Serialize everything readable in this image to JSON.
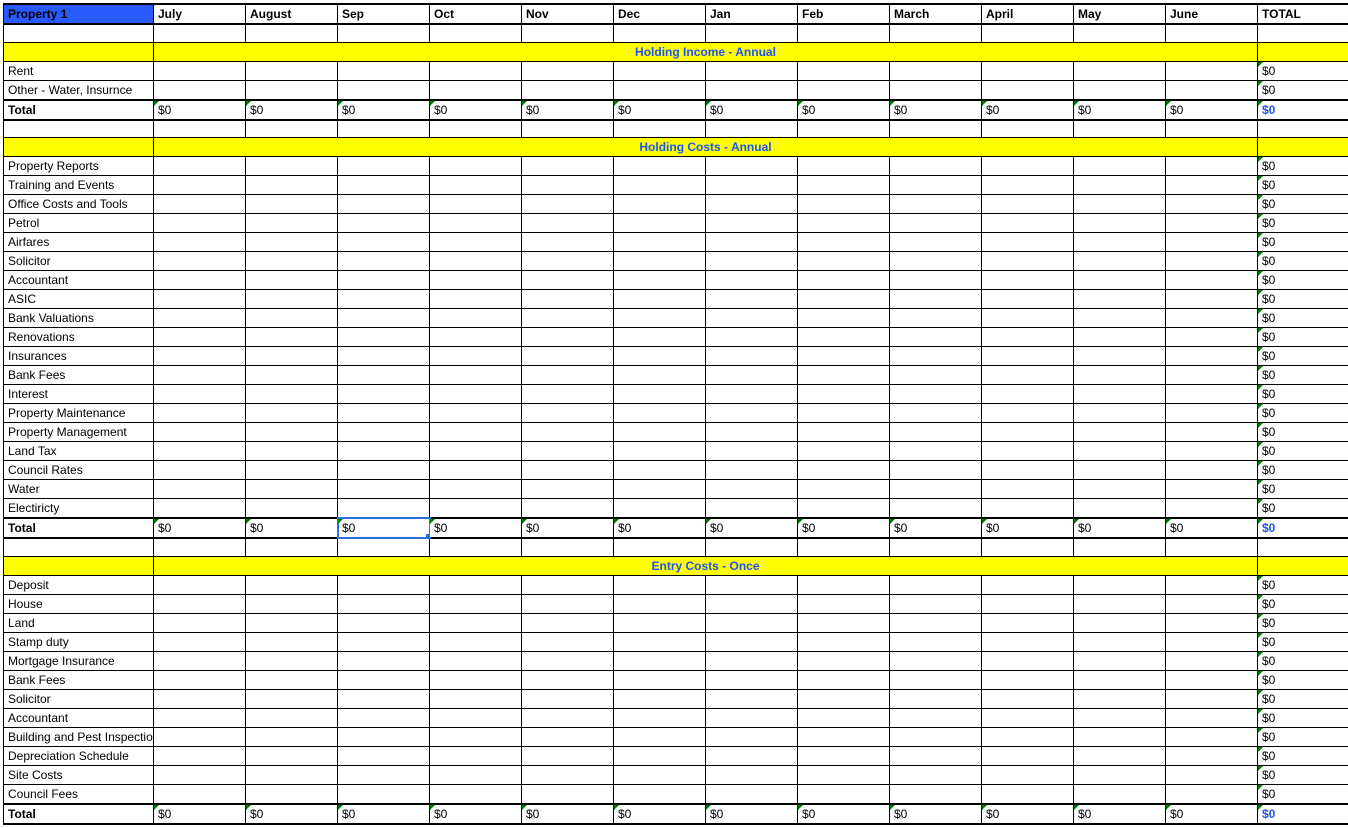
{
  "header": {
    "title": "Property 1",
    "months": [
      "July",
      "August",
      "Sep",
      "Oct",
      "Nov",
      "Dec",
      "Jan",
      "Feb",
      "March",
      "April",
      "May",
      "June"
    ],
    "total_label": "TOTAL"
  },
  "sections": [
    {
      "title": "Holding Income - Annual",
      "rows": [
        {
          "label": "Rent",
          "total": "$0"
        },
        {
          "label": "Other - Water, Insurnce",
          "total": "$0"
        }
      ],
      "total": {
        "label": "Total",
        "months": [
          "$0",
          "$0",
          "$0",
          "$0",
          "$0",
          "$0",
          "$0",
          "$0",
          "$0",
          "$0",
          "$0",
          "$0"
        ],
        "grand": "$0"
      }
    },
    {
      "title": "Holding Costs - Annual",
      "rows": [
        {
          "label": "Property Reports",
          "total": "$0"
        },
        {
          "label": "Training and Events",
          "total": "$0"
        },
        {
          "label": "Office Costs and Tools",
          "total": "$0"
        },
        {
          "label": "Petrol",
          "total": "$0"
        },
        {
          "label": "Airfares",
          "total": "$0"
        },
        {
          "label": "Solicitor",
          "total": "$0"
        },
        {
          "label": "Accountant",
          "total": "$0"
        },
        {
          "label": "ASIC",
          "total": "$0"
        },
        {
          "label": "Bank Valuations",
          "total": "$0"
        },
        {
          "label": "Renovations",
          "total": "$0"
        },
        {
          "label": "Insurances",
          "total": "$0"
        },
        {
          "label": "Bank Fees",
          "total": "$0"
        },
        {
          "label": "Interest",
          "total": "$0"
        },
        {
          "label": "Property Maintenance",
          "total": "$0"
        },
        {
          "label": "Property Management",
          "total": "$0"
        },
        {
          "label": "Land Tax",
          "total": "$0"
        },
        {
          "label": "Council Rates",
          "total": "$0"
        },
        {
          "label": "Water",
          "total": "$0"
        },
        {
          "label": "Electiricty",
          "total": "$0"
        }
      ],
      "total": {
        "label": "Total",
        "months": [
          "$0",
          "$0",
          "$0",
          "$0",
          "$0",
          "$0",
          "$0",
          "$0",
          "$0",
          "$0",
          "$0",
          "$0"
        ],
        "grand": "$0"
      }
    },
    {
      "title": "Entry Costs - Once",
      "rows": [
        {
          "label": "Deposit",
          "total": "$0"
        },
        {
          "label": "House",
          "total": "$0"
        },
        {
          "label": "Land",
          "total": "$0"
        },
        {
          "label": "Stamp duty",
          "total": "$0"
        },
        {
          "label": "Mortgage Insurance",
          "total": "$0"
        },
        {
          "label": "Bank Fees",
          "total": "$0"
        },
        {
          "label": "Solicitor",
          "total": "$0"
        },
        {
          "label": "Accountant",
          "total": "$0"
        },
        {
          "label": "Building and Pest Inspection",
          "total": "$0"
        },
        {
          "label": "Depreciation Schedule",
          "total": "$0"
        },
        {
          "label": "Site Costs",
          "total": "$0"
        },
        {
          "label": "Council Fees",
          "total": "$0"
        }
      ],
      "total": {
        "label": "Total",
        "months": [
          "$0",
          "$0",
          "$0",
          "$0",
          "$0",
          "$0",
          "$0",
          "$0",
          "$0",
          "$0",
          "$0",
          "$0"
        ],
        "grand": "$0"
      }
    }
  ],
  "selected_cell": {
    "section": 1,
    "kind": "total_month",
    "month_index": 2
  }
}
